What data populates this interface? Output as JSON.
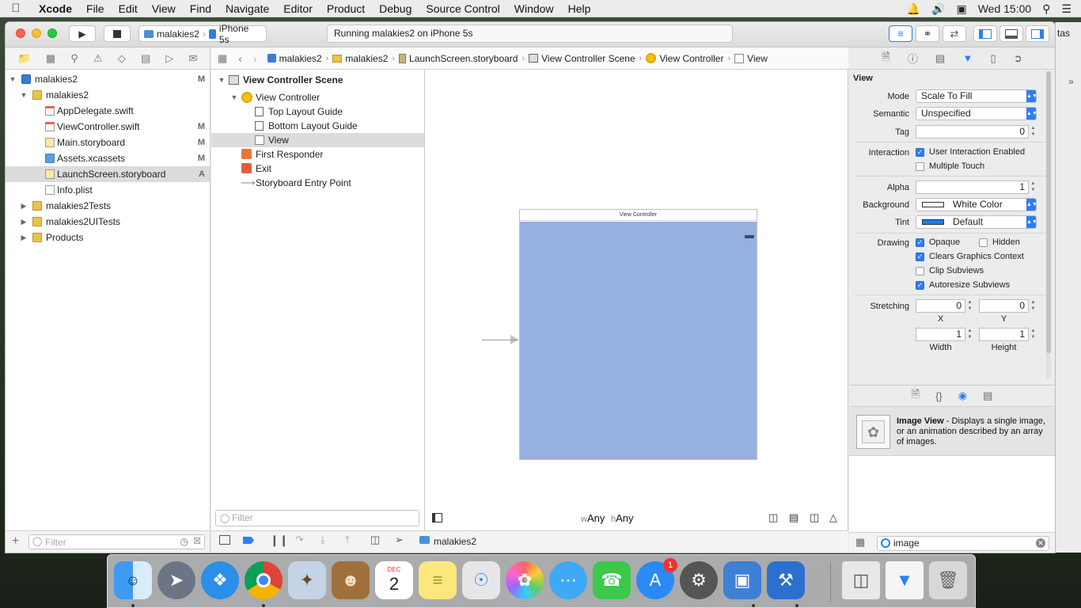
{
  "menubar": {
    "apple": "",
    "app": "Xcode",
    "items": [
      "File",
      "Edit",
      "View",
      "Find",
      "Navigate",
      "Editor",
      "Product",
      "Debug",
      "Source Control",
      "Window",
      "Help"
    ],
    "clock": "Wed 15:00"
  },
  "toolbar": {
    "scheme": "malakies2",
    "device": "iPhone 5s",
    "activity": "Running malakies2 on iPhone 5s",
    "right_partial": "tas"
  },
  "navigator": {
    "items": [
      {
        "label": "malakies2",
        "status": "M",
        "type": "project"
      },
      {
        "label": "malakies2",
        "status": "",
        "type": "folder"
      },
      {
        "label": "AppDelegate.swift",
        "status": "",
        "type": "swift"
      },
      {
        "label": "ViewController.swift",
        "status": "M",
        "type": "swift"
      },
      {
        "label": "Main.storyboard",
        "status": "M",
        "type": "storyboard"
      },
      {
        "label": "Assets.xcassets",
        "status": "M",
        "type": "assets"
      },
      {
        "label": "LaunchScreen.storyboard",
        "status": "A",
        "type": "storyboard"
      },
      {
        "label": "Info.plist",
        "status": "",
        "type": "plist"
      },
      {
        "label": "malakies2Tests",
        "status": "",
        "type": "folder"
      },
      {
        "label": "malakies2UITests",
        "status": "",
        "type": "folder"
      },
      {
        "label": "Products",
        "status": "",
        "type": "folder"
      }
    ],
    "filter_placeholder": "Filter"
  },
  "jumpbar": {
    "crumbs": [
      "malakies2",
      "malakies2",
      "LaunchScreen.storyboard",
      "View Controller Scene",
      "View Controller",
      "View"
    ]
  },
  "outline": {
    "items": [
      {
        "label": "View Controller Scene"
      },
      {
        "label": "View Controller"
      },
      {
        "label": "Top Layout Guide"
      },
      {
        "label": "Bottom Layout Guide"
      },
      {
        "label": "View"
      },
      {
        "label": "First Responder"
      },
      {
        "label": "Exit"
      },
      {
        "label": "Storyboard Entry Point"
      }
    ],
    "filter_placeholder": "Filter"
  },
  "canvas": {
    "scene_title": "View Controller",
    "view_color": "#95b0e1",
    "size_class_w": "w",
    "size_class_w_value": "Any",
    "size_class_h": "h",
    "size_class_h_value": "Any"
  },
  "bottombar": {
    "target": "malakies2"
  },
  "inspector": {
    "section": "View",
    "mode_label": "Mode",
    "mode_value": "Scale To Fill",
    "semantic_label": "Semantic",
    "semantic_value": "Unspecified",
    "tag_label": "Tag",
    "tag_value": "0",
    "interaction_label": "Interaction",
    "user_interaction": "User Interaction Enabled",
    "multiple_touch": "Multiple Touch",
    "alpha_label": "Alpha",
    "alpha_value": "1",
    "background_label": "Background",
    "background_value": "White Color",
    "tint_label": "Tint",
    "tint_value": "Default",
    "drawing_label": "Drawing",
    "opaque": "Opaque",
    "hidden": "Hidden",
    "clears_graphics": "Clears Graphics Context",
    "clip_subviews": "Clip Subviews",
    "autoresize_subviews": "Autoresize Subviews",
    "stretching_label": "Stretching",
    "stretch_x_value": "0",
    "stretch_y_value": "0",
    "x_label": "X",
    "y_label": "Y",
    "stretch_w_value": "1",
    "stretch_h_value": "1",
    "width_label": "Width",
    "height_label": "Height"
  },
  "library": {
    "item_title": "Image View",
    "item_desc": " - Displays a single image, or an animation described by an array of images.",
    "search_value": "image"
  },
  "dock": {
    "calendar_month": "DEC",
    "calendar_day": "2",
    "appstore_badge": "1"
  }
}
